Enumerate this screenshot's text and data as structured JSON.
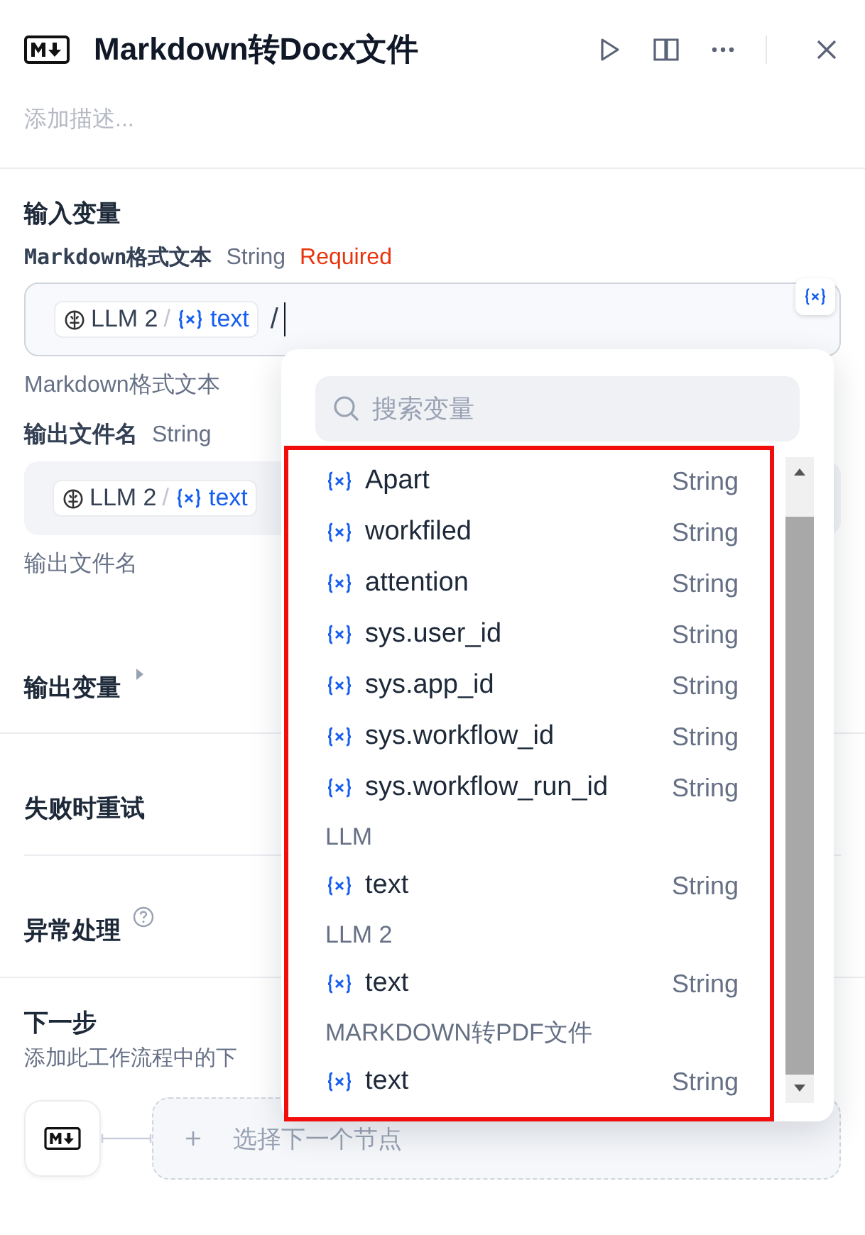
{
  "header": {
    "title": "Markdown转Docx文件",
    "description_placeholder": "添加描述..."
  },
  "input_section": {
    "title": "输入变量",
    "fields": [
      {
        "label": "Markdown格式文本",
        "type": "String",
        "required_label": "Required",
        "chip": {
          "node": "LLM 2",
          "separator": "/",
          "variable": "text"
        },
        "typed": "/",
        "hint": "Markdown格式文本"
      },
      {
        "label": "输出文件名",
        "type": "String",
        "chip": {
          "node": "LLM 2",
          "separator": "/",
          "variable": "text"
        },
        "hint": "输出文件名"
      }
    ]
  },
  "output_vars": {
    "title": "输出变量",
    "expanded": false
  },
  "retry": {
    "title": "失败时重试"
  },
  "error_handling": {
    "title": "异常处理"
  },
  "next_step": {
    "title": "下一步",
    "description": "添加此工作流程中的下",
    "add_label": "选择下一个节点"
  },
  "variable_picker": {
    "search_placeholder": "搜索变量",
    "items": [
      {
        "kind": "variable",
        "name": "Apart",
        "type": "String"
      },
      {
        "kind": "variable",
        "name": "workfiled",
        "type": "String"
      },
      {
        "kind": "variable",
        "name": "attention",
        "type": "String"
      },
      {
        "kind": "variable",
        "name": "sys.user_id",
        "type": "String"
      },
      {
        "kind": "variable",
        "name": "sys.app_id",
        "type": "String"
      },
      {
        "kind": "variable",
        "name": "sys.workflow_id",
        "type": "String"
      },
      {
        "kind": "variable",
        "name": "sys.workflow_run_id",
        "type": "String"
      },
      {
        "kind": "group",
        "name": "LLM"
      },
      {
        "kind": "variable",
        "name": "text",
        "type": "String"
      },
      {
        "kind": "group",
        "name": "LLM 2"
      },
      {
        "kind": "variable",
        "name": "text",
        "type": "String"
      },
      {
        "kind": "group",
        "name": "MARKDOWN转PDF文件"
      },
      {
        "kind": "variable",
        "name": "text",
        "type": "String"
      }
    ]
  }
}
